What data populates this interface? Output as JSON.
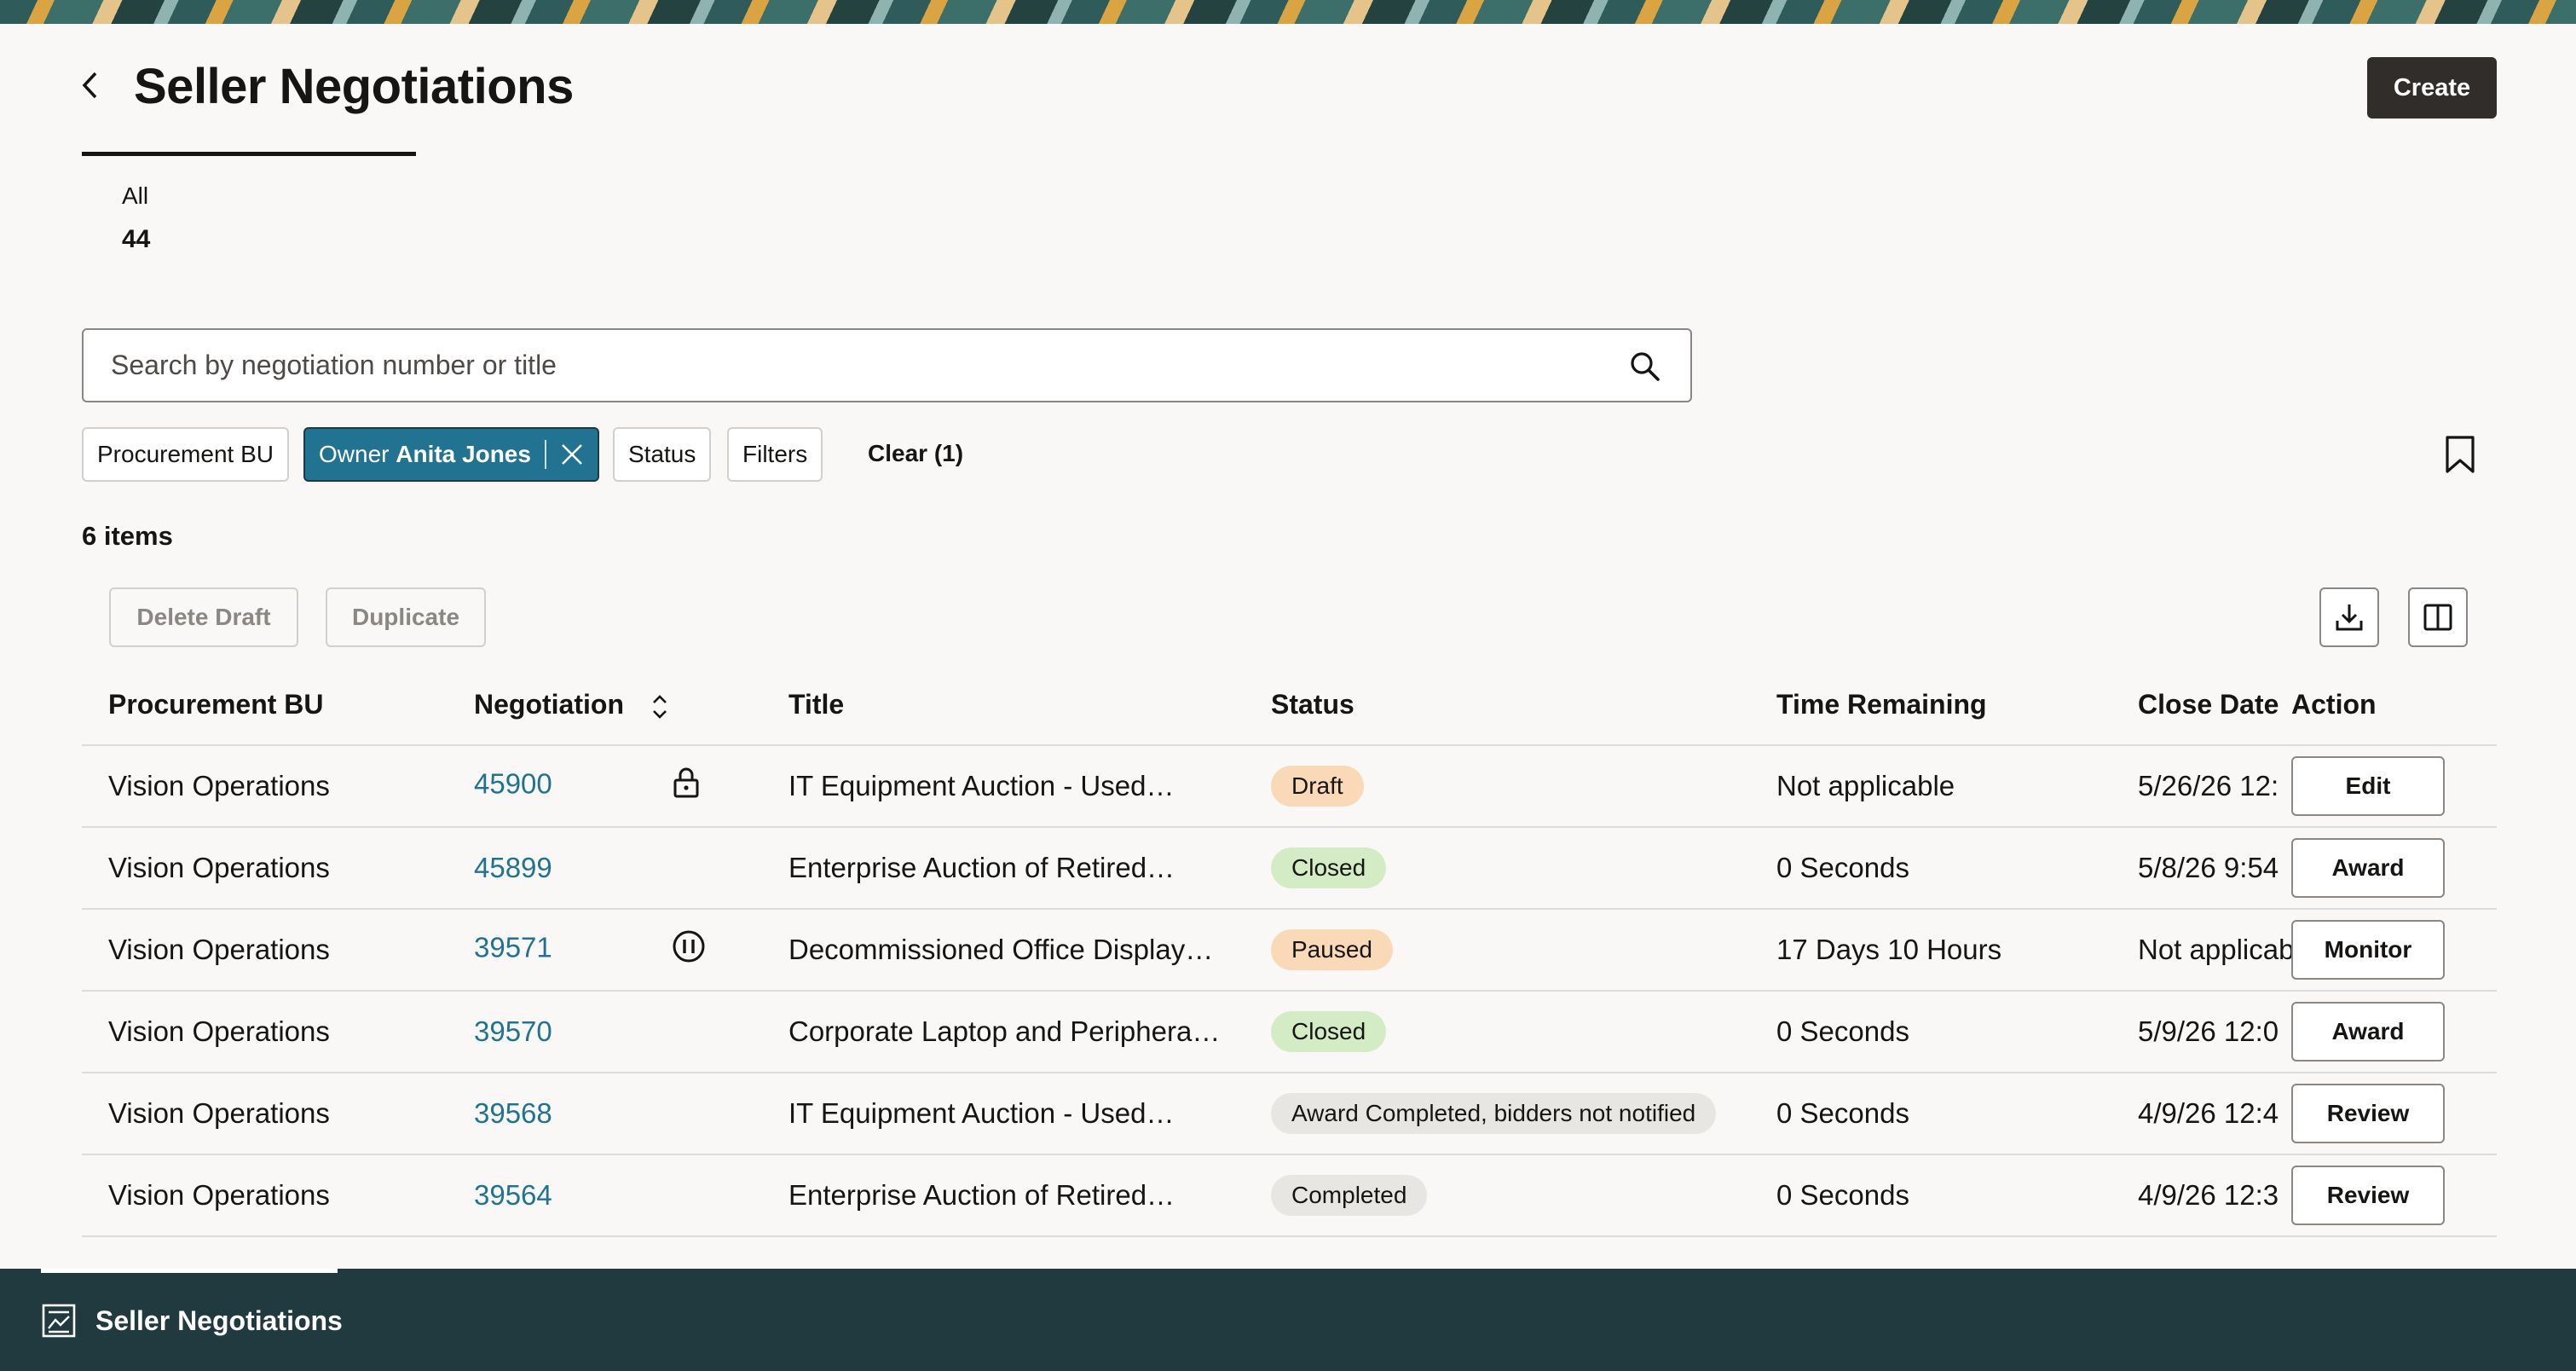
{
  "header": {
    "title": "Seller Negotiations",
    "create_label": "Create"
  },
  "summary": {
    "label": "All",
    "count": "44"
  },
  "search": {
    "placeholder": "Search by negotiation number or title"
  },
  "filters": {
    "procurement_bu": "Procurement BU",
    "owner_prefix": "Owner",
    "owner_value": "Anita Jones",
    "status": "Status",
    "filters": "Filters",
    "clear": "Clear (1)"
  },
  "items_count": "6 items",
  "toolbar": {
    "delete_draft": "Delete Draft",
    "duplicate": "Duplicate"
  },
  "table": {
    "headers": {
      "procurement_bu": "Procurement BU",
      "negotiation": "Negotiation",
      "title": "Title",
      "status": "Status",
      "time_remaining": "Time Remaining",
      "close_date": "Close Date",
      "action": "Action"
    },
    "rows": [
      {
        "bu": "Vision Operations",
        "negotiation": "45900",
        "icon": "lock-icon",
        "title": "IT Equipment Auction - Used…",
        "status": "Draft",
        "status_kind": "draft",
        "time_remaining": "Not applicable",
        "close_date": "5/26/26 12:",
        "action": "Edit"
      },
      {
        "bu": "Vision Operations",
        "negotiation": "45899",
        "icon": "",
        "title": "Enterprise Auction of Retired…",
        "status": "Closed",
        "status_kind": "closed",
        "time_remaining": "0 Seconds",
        "close_date": "5/8/26 9:54",
        "action": "Award"
      },
      {
        "bu": "Vision Operations",
        "negotiation": "39571",
        "icon": "pause-icon",
        "title": "Decommissioned Office Display…",
        "status": "Paused",
        "status_kind": "paused",
        "time_remaining": "17 Days 10 Hours",
        "close_date": "Not applicab",
        "action": "Monitor"
      },
      {
        "bu": "Vision Operations",
        "negotiation": "39570",
        "icon": "",
        "title": "Corporate Laptop and Periphera…",
        "status": "Closed",
        "status_kind": "closed",
        "time_remaining": "0 Seconds",
        "close_date": "5/9/26 12:0",
        "action": "Award"
      },
      {
        "bu": "Vision Operations",
        "negotiation": "39568",
        "icon": "",
        "title": "IT Equipment Auction - Used…",
        "status": "Award Completed, bidders not notified",
        "status_kind": "neutral",
        "time_remaining": "0 Seconds",
        "close_date": "4/9/26 12:4",
        "action": "Review"
      },
      {
        "bu": "Vision Operations",
        "negotiation": "39564",
        "icon": "",
        "title": "Enterprise Auction of Retired…",
        "status": "Completed",
        "status_kind": "neutral",
        "time_remaining": "0 Seconds",
        "close_date": "4/9/26 12:3",
        "action": "Review"
      }
    ]
  },
  "footer": {
    "nav_label": "Seller Negotiations"
  },
  "colors": {
    "link": "#227391",
    "primary_button": "#312d2a",
    "footer_bg": "#203a3f",
    "chip_active": "#227391"
  }
}
